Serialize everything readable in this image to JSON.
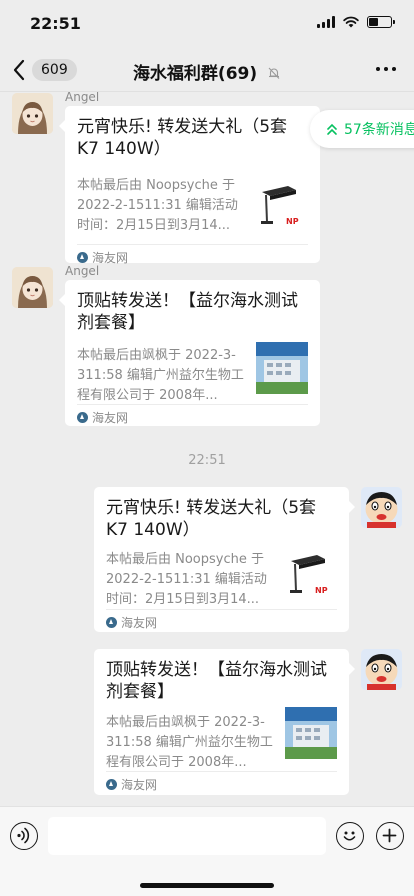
{
  "status_bar": {
    "time": "22:51",
    "battery_level": 0.45
  },
  "nav": {
    "back_count": "609",
    "title": "海水福利群(69)",
    "muted": true
  },
  "new_messages": {
    "label": "57条新消息"
  },
  "messages": [
    {
      "sender": "Angel",
      "title": "元宵快乐! 转发送大礼（5套K7  140W）",
      "desc": "本帖最后由 Noopsyche 于 2022-2-1511:31 编辑活动时间：2月15日到3月14...",
      "source": "海友网",
      "thumb": "lamp"
    },
    {
      "sender": "Angel",
      "title": "顶贴转发送！【益尔海水测试剂套餐】",
      "desc": "本帖最后由飒枫于 2022-3-311:58 编辑广州益尔生物工程有限公司于 2008年...",
      "source": "海友网",
      "thumb": "building"
    },
    {
      "title": "元宵快乐! 转发送大礼（5套K7  140W）",
      "desc": "本帖最后由 Noopsyche 于 2022-2-1511:31 编辑活动时间：2月15日到3月14...",
      "source": "海友网",
      "thumb": "lamp"
    },
    {
      "title": "顶贴转发送！【益尔海水测试剂套餐】",
      "desc": "本帖最后由飒枫于 2022-3-311:58 编辑广州益尔生物工程有限公司于 2008年...",
      "source": "海友网",
      "thumb": "building"
    }
  ],
  "timestamp": "22:51",
  "input": {
    "value": ""
  }
}
